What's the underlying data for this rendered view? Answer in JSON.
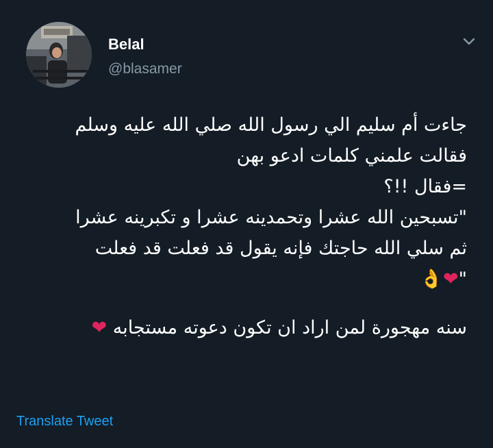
{
  "user": {
    "name": "Belal",
    "handle": "@blasamer"
  },
  "icons": {
    "avatar": "profile-photo",
    "menu": "chevron-down-icon"
  },
  "tweet": {
    "lines": [
      "جاءت أم سليم الي رسول الله صلي الله عليه وسلم",
      "فقالت علمني كلمات ادعو بهن",
      "=فقال !!؟",
      "\"تسبحين الله عشرا وتحمدينه عشرا و تكبرينه عشرا",
      "ثم سلي الله حاجتك فإنه يقول قد فعلت قد فعلت",
      "\"",
      "سنه مهجورة لمن اراد ان تكون دعوته مستجابه"
    ],
    "emojis": {
      "heart": "❤",
      "ok_hand": "👌"
    }
  },
  "translate_label": "Translate Tweet",
  "colors": {
    "background": "#141d26",
    "text": "#ffffff",
    "secondary": "#8899a6",
    "link": "#1da1f2",
    "heart": "#e0245e"
  }
}
